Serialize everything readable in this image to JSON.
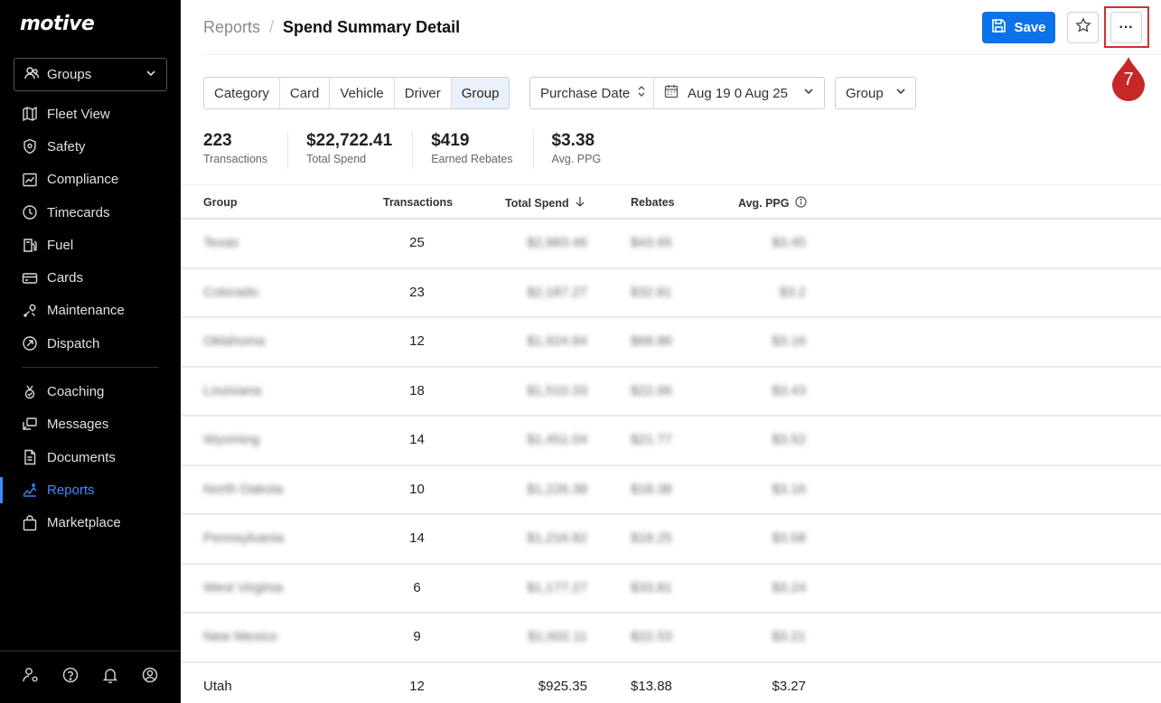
{
  "sidebar": {
    "logo": "motive",
    "group_select": {
      "label": "Groups",
      "icon": "users-icon"
    },
    "items_top": [
      {
        "label": "Fleet View",
        "icon": "map-icon",
        "active": false
      },
      {
        "label": "Safety",
        "icon": "shield-icon",
        "active": false
      },
      {
        "label": "Compliance",
        "icon": "chart-icon",
        "active": false
      },
      {
        "label": "Timecards",
        "icon": "clock-icon",
        "active": false
      },
      {
        "label": "Fuel",
        "icon": "fuel-icon",
        "active": false
      },
      {
        "label": "Cards",
        "icon": "card-icon",
        "active": false
      },
      {
        "label": "Maintenance",
        "icon": "wrench-icon",
        "active": false
      },
      {
        "label": "Dispatch",
        "icon": "dispatch-icon",
        "active": false
      }
    ],
    "items_bottom": [
      {
        "label": "Coaching",
        "icon": "coaching-icon",
        "active": false
      },
      {
        "label": "Messages",
        "icon": "messages-icon",
        "active": false
      },
      {
        "label": "Documents",
        "icon": "document-icon",
        "active": false
      },
      {
        "label": "Reports",
        "icon": "reports-icon",
        "active": true
      },
      {
        "label": "Marketplace",
        "icon": "bag-icon",
        "active": false
      }
    ],
    "footer_icons": [
      "user-settings-icon",
      "help-icon",
      "bell-icon",
      "account-icon"
    ]
  },
  "header": {
    "breadcrumb_parent": "Reports",
    "breadcrumb_sep": "/",
    "title": "Spend Summary Detail",
    "save_label": "Save",
    "more_label": "···",
    "step_marker": "7",
    "accent": "#0c72e8",
    "marker_color": "#c62828"
  },
  "filters": {
    "segments": [
      {
        "label": "Category",
        "selected": false
      },
      {
        "label": "Card",
        "selected": false
      },
      {
        "label": "Vehicle",
        "selected": false
      },
      {
        "label": "Driver",
        "selected": false
      },
      {
        "label": "Group",
        "selected": true
      }
    ],
    "date_sort_label": "Purchase Date",
    "date_range": "Aug 19 0 Aug 25",
    "group_dropdown": "Group"
  },
  "stats": [
    {
      "value": "223",
      "label": "Transactions"
    },
    {
      "value": "$22,722.41",
      "label": "Total Spend"
    },
    {
      "value": "$419",
      "label": "Earned Rebates"
    },
    {
      "value": "$3.38",
      "label": "Avg. PPG"
    }
  ],
  "table": {
    "columns": [
      "Group",
      "Transactions",
      "Total Spend",
      "Rebates",
      "Avg. PPG"
    ],
    "rows": [
      {
        "group": "Texas",
        "transactions": "25",
        "spend": "$2,983.46",
        "rebates": "$43.65",
        "ppg": "$3.45",
        "blurred": true
      },
      {
        "group": "Colorado",
        "transactions": "23",
        "spend": "$2,187.27",
        "rebates": "$32.81",
        "ppg": "$3.2",
        "blurred": true
      },
      {
        "group": "Oklahoma",
        "transactions": "12",
        "spend": "$1,924.84",
        "rebates": "$68.86",
        "ppg": "$3.16",
        "blurred": true
      },
      {
        "group": "Louisiana",
        "transactions": "18",
        "spend": "$1,510.33",
        "rebates": "$22.66",
        "ppg": "$3.43",
        "blurred": true
      },
      {
        "group": "Wyoming",
        "transactions": "14",
        "spend": "$1,451.04",
        "rebates": "$21.77",
        "ppg": "$3.52",
        "blurred": true
      },
      {
        "group": "North Dakota",
        "transactions": "10",
        "spend": "$1,226.38",
        "rebates": "$18.38",
        "ppg": "$3.16",
        "blurred": true
      },
      {
        "group": "Pennsylvania",
        "transactions": "14",
        "spend": "$1,216.82",
        "rebates": "$18.25",
        "ppg": "$3.58",
        "blurred": true
      },
      {
        "group": "West Virginia",
        "transactions": "6",
        "spend": "$1,177.27",
        "rebates": "$33.81",
        "ppg": "$3.24",
        "blurred": true
      },
      {
        "group": "New Mexico",
        "transactions": "9",
        "spend": "$1,002.11",
        "rebates": "$22.53",
        "ppg": "$3.21",
        "blurred": true
      },
      {
        "group": "Utah",
        "transactions": "12",
        "spend": "$925.35",
        "rebates": "$13.88",
        "ppg": "$3.27",
        "blurred": false
      }
    ]
  }
}
